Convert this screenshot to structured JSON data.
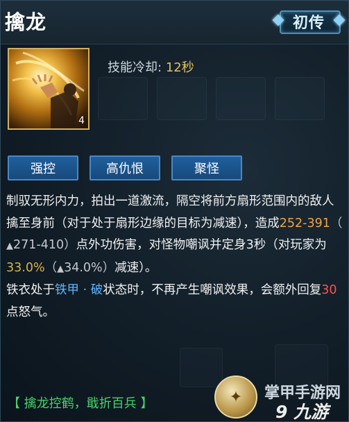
{
  "skill": {
    "name": "擒龙",
    "rank_label": "初传",
    "level": "4",
    "cooldown_label": "技能冷却:",
    "cooldown_value": "12秒"
  },
  "tags": [
    "强控",
    "高仇恨",
    "聚怪"
  ],
  "description": {
    "p1": {
      "t1": "制驭无形内力，拍出一道激流，隔空将前方扇形范围内的敌人擒至身前（对于处于扇形边缘的目标为减速），造成",
      "dmg": "252-391",
      "open": "（",
      "arrow": "▲",
      "dmg_up": "271-410",
      "close": "）",
      "t2": "点外功伤害，对怪物嘲讽并定身3秒（对玩家为",
      "slow": "33.0%",
      "open2": "（",
      "arrow2": "▲",
      "slow_up": "34.0%",
      "close2": "）",
      "t3": "减速）。"
    },
    "p2": {
      "t1": "铁衣处于",
      "state": "铁甲 · 破",
      "t2": "状态时，不再产生嘲讽效果，会额外回复",
      "rage": "30",
      "t3": "点怒气。"
    }
  },
  "footer": "【 擒龙控鹤，戢折百兵 】",
  "watermark": {
    "line1": "掌甲手游网",
    "line2": "9 九游"
  },
  "colors": {
    "tag_bg": "#1f5f9d",
    "damage": "#f4a340",
    "percent": "#d9b34a",
    "state": "#5eb6ff",
    "rage": "#ff5252",
    "footer": "#49d36c"
  }
}
